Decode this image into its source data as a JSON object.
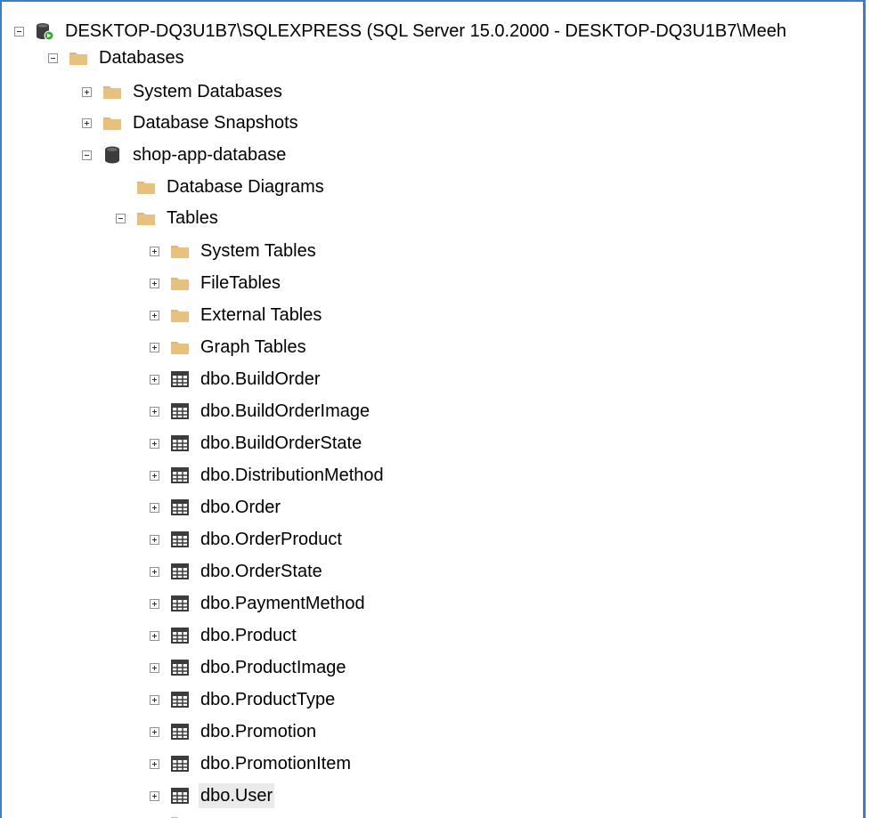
{
  "tree": {
    "server": {
      "label": "DESKTOP-DQ3U1B7\\SQLEXPRESS (SQL Server 15.0.2000 - DESKTOP-DQ3U1B7\\Meeh",
      "icon": "server-connected-icon"
    },
    "databases": {
      "label": "Databases",
      "icon": "folder-icon"
    },
    "system_databases": {
      "label": "System Databases",
      "icon": "folder-icon"
    },
    "database_snapshots": {
      "label": "Database Snapshots",
      "icon": "folder-icon"
    },
    "database": {
      "label": "shop-app-database",
      "icon": "database-icon"
    },
    "database_diagrams": {
      "label": "Database Diagrams",
      "icon": "folder-icon"
    },
    "tables": {
      "label": "Tables",
      "icon": "folder-icon"
    },
    "table_folders": [
      {
        "label": "System Tables",
        "icon": "folder-icon"
      },
      {
        "label": "FileTables",
        "icon": "folder-icon"
      },
      {
        "label": "External Tables",
        "icon": "folder-icon"
      },
      {
        "label": "Graph Tables",
        "icon": "folder-icon"
      }
    ],
    "user_tables": [
      {
        "label": "dbo.BuildOrder",
        "icon": "table-icon"
      },
      {
        "label": "dbo.BuildOrderImage",
        "icon": "table-icon"
      },
      {
        "label": "dbo.BuildOrderState",
        "icon": "table-icon"
      },
      {
        "label": "dbo.DistributionMethod",
        "icon": "table-icon"
      },
      {
        "label": "dbo.Order",
        "icon": "table-icon"
      },
      {
        "label": "dbo.OrderProduct",
        "icon": "table-icon"
      },
      {
        "label": "dbo.OrderState",
        "icon": "table-icon"
      },
      {
        "label": "dbo.PaymentMethod",
        "icon": "table-icon"
      },
      {
        "label": "dbo.Product",
        "icon": "table-icon"
      },
      {
        "label": "dbo.ProductImage",
        "icon": "table-icon"
      },
      {
        "label": "dbo.ProductType",
        "icon": "table-icon"
      },
      {
        "label": "dbo.Promotion",
        "icon": "table-icon"
      },
      {
        "label": "dbo.PromotionItem",
        "icon": "table-icon"
      },
      {
        "label": "dbo.User",
        "icon": "table-icon",
        "selected": true
      }
    ]
  },
  "colors": {
    "accent_border": "#3f7ec4",
    "folder": "#dcb67a",
    "selection": "#eaeaea"
  }
}
